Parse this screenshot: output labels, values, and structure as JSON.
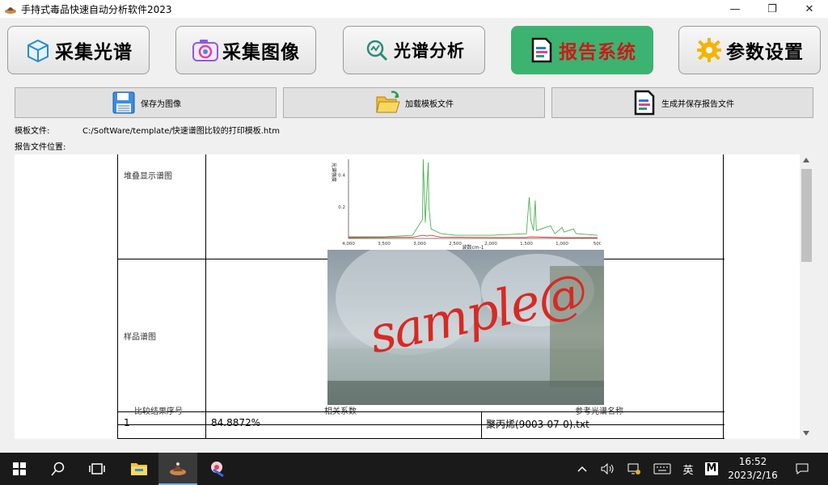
{
  "window": {
    "title": "手持式毒品快速自动分析软件2023",
    "controls": [
      "—",
      "❐",
      "✕"
    ]
  },
  "nav": {
    "items": [
      {
        "label": "采集光谱",
        "icon": "box-icon"
      },
      {
        "label": "采集图像",
        "icon": "camera-icon"
      },
      {
        "label": "光谱分析",
        "icon": "magnify-chart-icon"
      },
      {
        "label": "报告系统",
        "icon": "report-icon",
        "active": true
      },
      {
        "label": "参数设置",
        "icon": "gear-icon"
      }
    ]
  },
  "toolbar": {
    "save_image": "保存为图像",
    "load_template": "加载模板文件",
    "generate_report": "生成并保存报告文件"
  },
  "info": {
    "template_label": "模板文件:",
    "template_value": "C:/SoftWare/template/快速谱图比较的打印模板.htm",
    "report_location_label": "报告文件位置:"
  },
  "report": {
    "stack_label": "堆叠显示谱图",
    "sample_label": "样品谱图",
    "sample_photo_text": "sample@",
    "results_headers": [
      "比较结果序号",
      "相关系数",
      "参考光谱名称"
    ],
    "results_rows": [
      {
        "index": "1",
        "coefficient": "84.8872%",
        "name": "聚丙烯(9003-07-0).txt"
      }
    ]
  },
  "chart_data": {
    "type": "line",
    "xlabel": "波数cm-1",
    "ylabel": "光谱强度",
    "xlim": [
      4000,
      500
    ],
    "ylim": [
      0,
      0.5
    ],
    "x_ticks": [
      "4,000",
      "3,500",
      "3,000",
      "2,500",
      "2,000",
      "1,500",
      "1,000",
      "500"
    ],
    "y_ticks": [
      "0.2",
      "0.4"
    ],
    "series": [
      {
        "color": "#4caf50",
        "x": [
          4000,
          3500,
          3100,
          2960,
          2950,
          2920,
          2880,
          2870,
          2840,
          2700,
          2500,
          2000,
          1500,
          1460,
          1440,
          1400,
          1376,
          1360,
          1160,
          1100,
          998,
          970,
          840,
          800,
          500
        ],
        "y": [
          0.01,
          0.01,
          0.02,
          0.12,
          0.5,
          0.1,
          0.48,
          0.2,
          0.06,
          0.03,
          0.02,
          0.02,
          0.03,
          0.26,
          0.12,
          0.05,
          0.24,
          0.05,
          0.08,
          0.03,
          0.07,
          0.04,
          0.06,
          0.03,
          0.02
        ]
      },
      {
        "color": "#e53935",
        "x": [
          4000,
          3500,
          3100,
          2950,
          2900,
          2850,
          2700,
          2000,
          1500,
          1450,
          1000,
          500
        ],
        "y": [
          0.005,
          0.006,
          0.008,
          0.02,
          0.015,
          0.02,
          0.008,
          0.006,
          0.006,
          0.01,
          0.005,
          0.005
        ]
      }
    ]
  },
  "taskbar": {
    "time": "16:52",
    "date": "2023/2/16",
    "ime": "英",
    "ime_mode": "M"
  }
}
